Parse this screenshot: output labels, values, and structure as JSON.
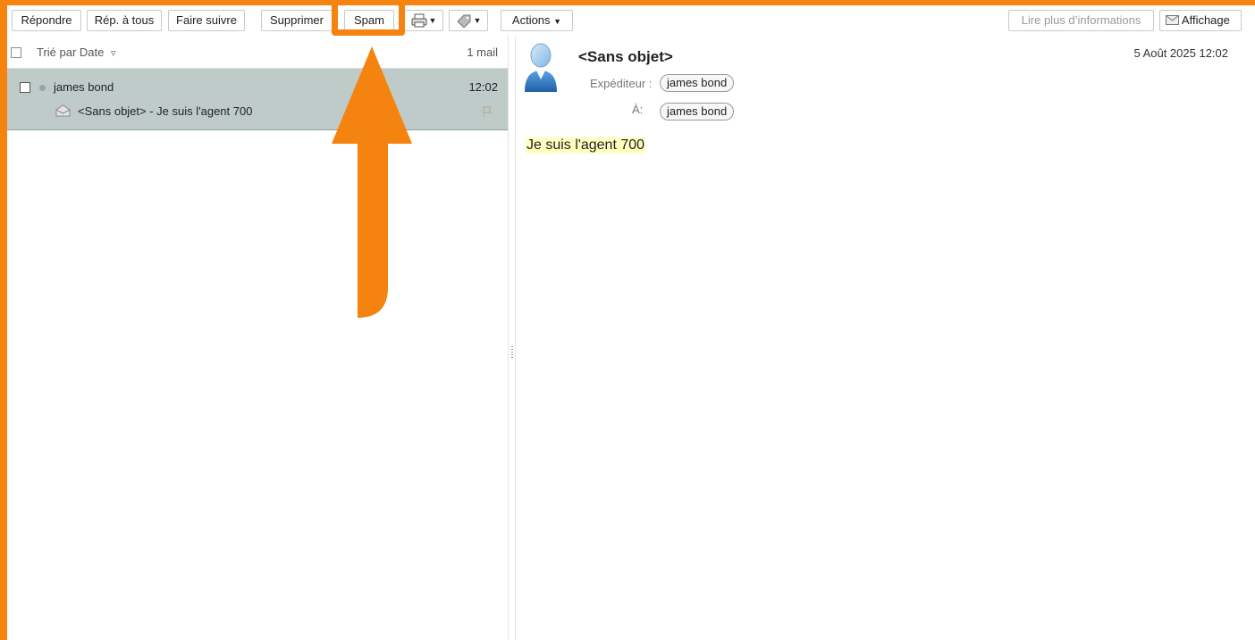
{
  "toolbar": {
    "reply": "Répondre",
    "reply_all": "Rép. à tous",
    "forward": "Faire suivre",
    "delete": "Supprimer",
    "spam": "Spam",
    "actions": "Actions",
    "more_info": "Lire plus d’informations",
    "view": "Affichage"
  },
  "list": {
    "sort_label": "Trié par Date",
    "count": "1 mail",
    "messages": [
      {
        "sender": "james bond",
        "time": "12:02",
        "subject": "<Sans objet> - Je suis l'agent 700"
      }
    ]
  },
  "message": {
    "subject": "<Sans objet>",
    "date": "5 Août 2025 12:02",
    "from_label": "Expéditeur :",
    "from": "james bond",
    "to_label": "À:",
    "to": "james bond",
    "body": "Je suis l'agent 700"
  },
  "colors": {
    "highlight": "#f5830f",
    "selected_row": "#bfcbc9"
  }
}
